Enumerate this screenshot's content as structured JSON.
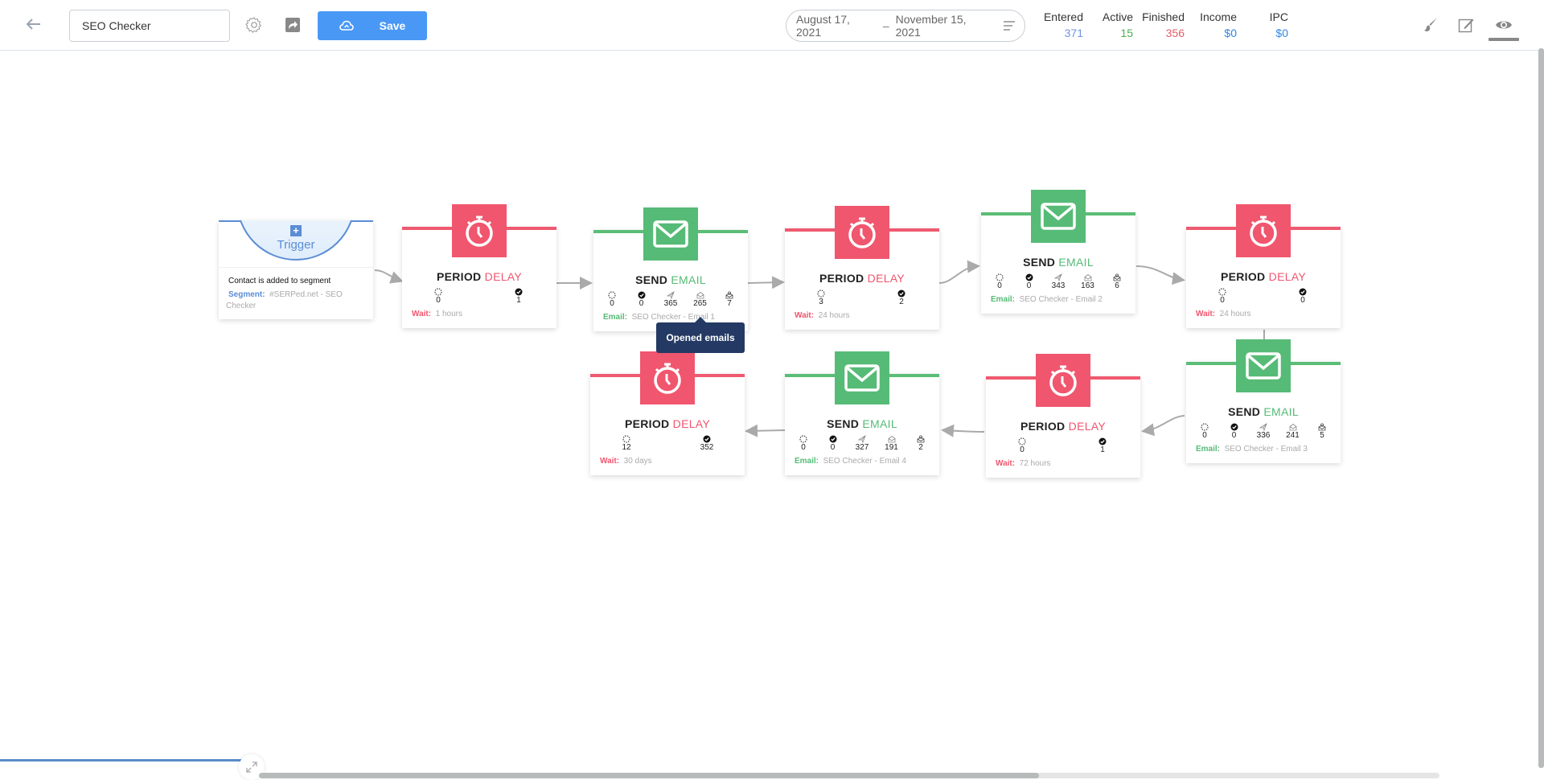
{
  "header": {
    "back_label": "←",
    "campaign_name": "SEO Checker",
    "save_label": "Save",
    "date_start": "August 17, 2021",
    "date_sep": "–",
    "date_end": "November 15, 2021",
    "stats": [
      {
        "label": "Entered",
        "value": "371",
        "color": "#6c93e6"
      },
      {
        "label": "Active",
        "value": "15",
        "color": "#4caf50"
      },
      {
        "label": "Finished",
        "value": "356",
        "color": "#e35d6a"
      },
      {
        "label": "Income",
        "value": "$0",
        "color": "#2f86e6"
      },
      {
        "label": "IPC",
        "value": "$0",
        "color": "#2f86e6"
      }
    ],
    "tools": [
      "brush-icon",
      "edit-icon",
      "eye-icon"
    ]
  },
  "trigger": {
    "label": "Trigger",
    "plus": "+",
    "description": "Contact is added to segment",
    "segment_key": "Segment:",
    "segment_value": "#SERPed.net - SEO Checker"
  },
  "colors": {
    "delay": "#f0566e",
    "email": "#56bb76",
    "trigger": "#5b8dd6",
    "primary": "#4a98f5"
  },
  "nodes": [
    {
      "type": "delay",
      "title1": "PERIOD",
      "title2": "DELAY",
      "waiting": "0",
      "done": "1",
      "foot_key": "Wait:",
      "foot_value": "1 hours"
    },
    {
      "type": "email",
      "title1": "SEND",
      "title2": "EMAIL",
      "waiting": "0",
      "done": "0",
      "sent": "365",
      "opened": "265",
      "clicked": "7",
      "foot_key": "Email:",
      "foot_value": "SEO Checker - Email 1"
    },
    {
      "type": "delay",
      "title1": "PERIOD",
      "title2": "DELAY",
      "waiting": "3",
      "done": "2",
      "foot_key": "Wait:",
      "foot_value": "24 hours"
    },
    {
      "type": "email",
      "title1": "SEND",
      "title2": "EMAIL",
      "waiting": "0",
      "done": "0",
      "sent": "343",
      "opened": "163",
      "clicked": "6",
      "foot_key": "Email:",
      "foot_value": "SEO Checker - Email 2"
    },
    {
      "type": "delay",
      "title1": "PERIOD",
      "title2": "DELAY",
      "waiting": "0",
      "done": "0",
      "foot_key": "Wait:",
      "foot_value": "24 hours"
    },
    {
      "type": "email",
      "title1": "SEND",
      "title2": "EMAIL",
      "waiting": "0",
      "done": "0",
      "sent": "336",
      "opened": "241",
      "clicked": "5",
      "foot_key": "Email:",
      "foot_value": "SEO Checker - Email 3"
    },
    {
      "type": "delay",
      "title1": "PERIOD",
      "title2": "DELAY",
      "waiting": "0",
      "done": "1",
      "foot_key": "Wait:",
      "foot_value": "72 hours"
    },
    {
      "type": "email",
      "title1": "SEND",
      "title2": "EMAIL",
      "waiting": "0",
      "done": "0",
      "sent": "327",
      "opened": "191",
      "clicked": "2",
      "foot_key": "Email:",
      "foot_value": "SEO Checker - Email 4"
    },
    {
      "type": "delay",
      "title1": "PERIOD",
      "title2": "DELAY",
      "waiting": "12",
      "done": "352",
      "foot_key": "Wait:",
      "foot_value": "30 days"
    }
  ],
  "tooltip": {
    "text": "Opened emails"
  }
}
